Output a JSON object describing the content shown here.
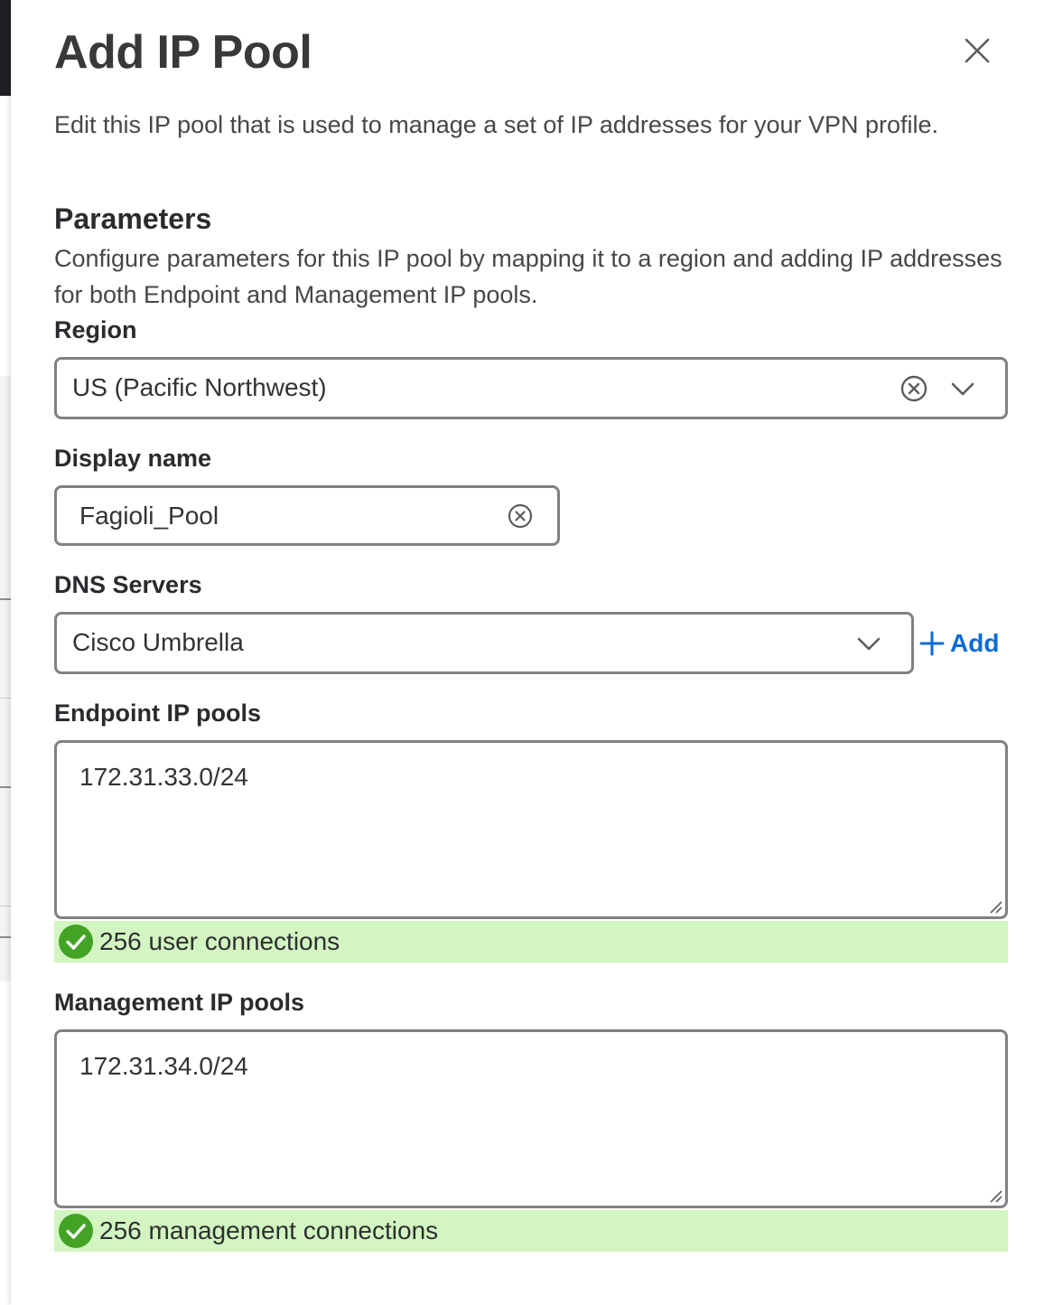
{
  "modal": {
    "title": "Add IP Pool",
    "description": "Edit this IP pool that is used to manage a set of IP addresses for your VPN profile."
  },
  "parameters": {
    "title": "Parameters",
    "description": "Configure parameters for this IP pool by mapping it to a region and adding IP addresses for both Endpoint and Management IP pools."
  },
  "region": {
    "label": "Region",
    "value": "US (Pacific Northwest)"
  },
  "display_name": {
    "label": "Display name",
    "value": "Fagioli_Pool"
  },
  "dns": {
    "label": "DNS Servers",
    "value": "Cisco Umbrella",
    "add_label": "Add"
  },
  "endpoint_pools": {
    "label": "Endpoint IP pools",
    "value": "172.31.33.0/24",
    "status": "256 user connections"
  },
  "management_pools": {
    "label": "Management IP pools",
    "value": "172.31.34.0/24",
    "status": "256 management connections"
  },
  "colors": {
    "accent": "#0d6bd4",
    "success_bg": "#d2f5c1",
    "success_icon": "#43a324",
    "border": "#808186"
  },
  "icons": {
    "close": "close-icon",
    "clear": "clear-circle-icon",
    "chevron": "chevron-down-icon",
    "plus": "plus-icon",
    "check": "check-circle-icon"
  }
}
